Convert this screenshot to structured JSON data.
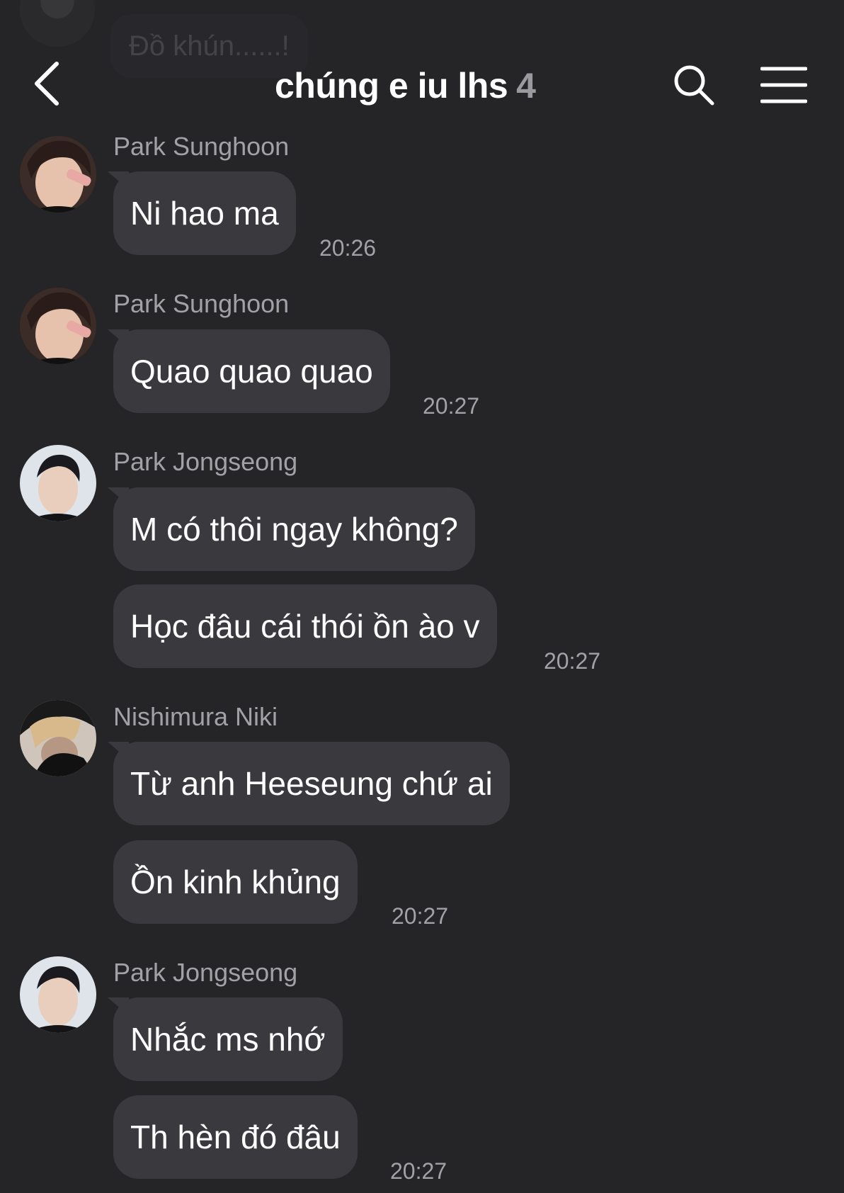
{
  "previous_message": "Đồ khún......!",
  "header": {
    "title": "chúng e iu lhs",
    "member_count": "4"
  },
  "icons": {
    "back": "chevron-left-icon",
    "search": "search-icon",
    "menu": "hamburger-menu-icon"
  },
  "messages": [
    {
      "sender": "Park Sunghoon",
      "bubbles": [
        "Ni hao ma"
      ],
      "time": "20:26"
    },
    {
      "sender": "Park Sunghoon",
      "bubbles": [
        "Quao quao quao"
      ],
      "time": "20:27"
    },
    {
      "sender": "Park Jongseong",
      "bubbles": [
        "M có thôi ngay không?",
        "Học đâu cái thói ồn ào v"
      ],
      "time": "20:27"
    },
    {
      "sender": "Nishimura Niki",
      "bubbles": [
        "Từ anh Heeseung chứ ai",
        "Ồn kinh khủng"
      ],
      "time": "20:27"
    },
    {
      "sender": "Park Jongseong",
      "bubbles": [
        "Nhắc ms nhớ",
        "Th hèn đó đâu"
      ],
      "time": "20:27"
    }
  ]
}
